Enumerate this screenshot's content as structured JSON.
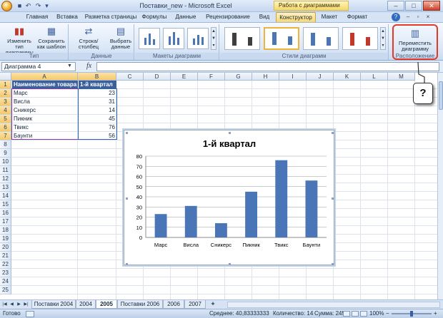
{
  "titlebar": {
    "window_title": "Поставки_new - Microsoft Excel",
    "context_title": "Работа с диаграммами",
    "minimize": "–",
    "maximize": "□",
    "close": "✕"
  },
  "tabs": [
    {
      "label": "Главная"
    },
    {
      "label": "Вставка"
    },
    {
      "label": "Разметка страницы"
    },
    {
      "label": "Формулы"
    },
    {
      "label": "Данные"
    },
    {
      "label": "Рецензирование"
    },
    {
      "label": "Вид"
    },
    {
      "label": "Конструктор"
    },
    {
      "label": "Макет"
    },
    {
      "label": "Формат"
    }
  ],
  "active_tab": "Конструктор",
  "ribbon": {
    "type_group": {
      "label": "Тип",
      "change_type": "Изменить тип диаграммы",
      "save_template": "Сохранить как шаблон"
    },
    "data_group": {
      "label": "Данные",
      "switch_row_col": "Строка/столбец",
      "select_data": "Выбрать данные"
    },
    "layouts_group": {
      "label": "Макеты диаграмм"
    },
    "styles_group": {
      "label": "Стили диаграмм",
      "style_colors": [
        "#3f3f3f",
        "#4a76b8",
        "#4a76b8",
        "#c0392b"
      ]
    },
    "location_group": {
      "label": "Расположение",
      "move_chart": "Переместить диаграмму"
    }
  },
  "formula_bar": {
    "name_box": "Диаграмма 4",
    "fx": "fx",
    "formula": ""
  },
  "columns": [
    "A",
    "B",
    "C",
    "D",
    "E",
    "F",
    "G",
    "H",
    "I",
    "J",
    "K",
    "L",
    "M"
  ],
  "rows": [
    "1",
    "2",
    "3",
    "4",
    "5",
    "6",
    "7",
    "8",
    "9",
    "10",
    "11",
    "12",
    "13",
    "14",
    "15",
    "16",
    "17",
    "18",
    "19",
    "20",
    "21",
    "22",
    "23",
    "24",
    "25"
  ],
  "table": {
    "header": [
      "Наименование товара",
      "1-й квартал"
    ],
    "rows": [
      [
        "Марс",
        "23"
      ],
      [
        "Висла",
        "31"
      ],
      [
        "Сникерс",
        "14"
      ],
      [
        "Пикник",
        "45"
      ],
      [
        "Твикс",
        "76"
      ],
      [
        "Баунти",
        "56"
      ]
    ]
  },
  "chart_data": {
    "type": "bar",
    "title": "1-й квартал",
    "categories": [
      "Марс",
      "Висла",
      "Сникерс",
      "Пикник",
      "Твикс",
      "Баунти"
    ],
    "values": [
      23,
      31,
      14,
      45,
      76,
      56
    ],
    "ylim": [
      0,
      80
    ],
    "yticks": [
      "0",
      "10",
      "20",
      "30",
      "40",
      "50",
      "60",
      "70",
      "80"
    ],
    "bar_color": "#4a76b8",
    "grid": true,
    "legend": "none"
  },
  "callout": {
    "text": "?"
  },
  "sheet_tabs": [
    "Поставки 2004",
    "2004",
    "2005",
    "Поставки 2006",
    "2006",
    "2007"
  ],
  "active_sheet": "2005",
  "status": {
    "ready": "Готово",
    "average": "Среднее: 40,83333333",
    "count": "Количество: 14",
    "sum": "Сумма: 245",
    "zoom": "100%"
  }
}
